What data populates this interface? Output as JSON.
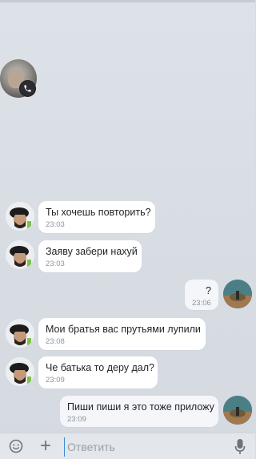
{
  "chat": {
    "messages": [
      {
        "side": "in",
        "text": "Ты хочешь повторить?",
        "time": "23:03"
      },
      {
        "side": "in",
        "text": "Заяву забери нахуй",
        "time": "23:03"
      },
      {
        "side": "out",
        "text": "?",
        "time": "23:06"
      },
      {
        "side": "in",
        "text": "Мои братья вас прутьями лупили",
        "time": "23:08"
      },
      {
        "side": "in",
        "text": "Че батька то деру дал?",
        "time": "23:09"
      },
      {
        "side": "out",
        "text": "Пиши пиши я это тоже приложу",
        "time": "23:09"
      }
    ]
  },
  "call_bubble": {
    "icon": "phone-icon"
  },
  "composer": {
    "placeholder": "Ответить",
    "value": "",
    "emoji_icon": "emoji-icon",
    "attach_icon": "plus-icon",
    "mic_icon": "microphone-icon"
  },
  "colors": {
    "background": "#d7dce3",
    "bubble_in": "#ffffff",
    "bubble_out": "#f4f6f9",
    "cursor": "#3f8ad8"
  }
}
